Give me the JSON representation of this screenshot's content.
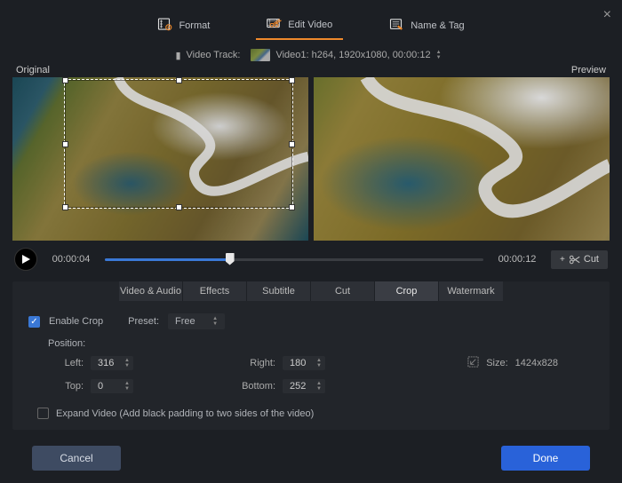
{
  "top_tabs": {
    "format": "Format",
    "edit_video": "Edit Video",
    "name_tag": "Name & Tag"
  },
  "track": {
    "label": "Video Track:",
    "value": "Video1: h264, 1920x1080, 00:00:12"
  },
  "pane_labels": {
    "original": "Original",
    "preview": "Preview"
  },
  "timeline": {
    "current": "00:00:04",
    "total": "00:00:12",
    "progress_pct": 33,
    "cut_label": "Cut"
  },
  "sub_tabs": [
    "Video & Audio",
    "Effects",
    "Subtitle",
    "Cut",
    "Crop",
    "Watermark"
  ],
  "sub_active": 4,
  "crop": {
    "enable_label": "Enable Crop",
    "preset_label": "Preset:",
    "preset_value": "Free",
    "position_label": "Position:",
    "left_label": "Left:",
    "left": "316",
    "right_label": "Right:",
    "right": "180",
    "top_label": "Top:",
    "top": "0",
    "bottom_label": "Bottom:",
    "bottom": "252",
    "size_label": "Size:",
    "size_value": "1424x828",
    "expand_label": "Expand Video (Add black padding to two sides of the video)"
  },
  "footer": {
    "cancel": "Cancel",
    "done": "Done"
  }
}
